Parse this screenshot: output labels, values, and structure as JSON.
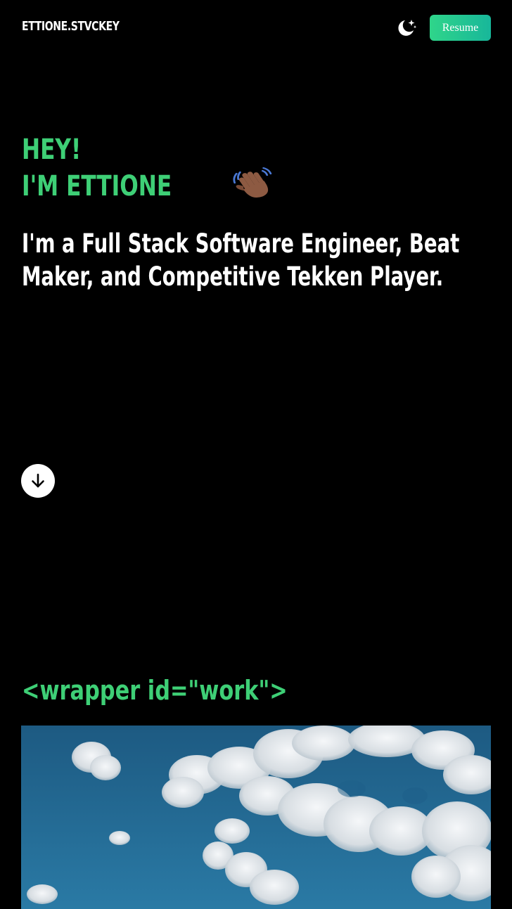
{
  "header": {
    "brand": "ETTIONE.STVCKEY",
    "theme_toggle_icon": "moon-stars-icon",
    "resume_label": "Resume",
    "accent_gradient": [
      "#2fd58a",
      "#18b79a"
    ]
  },
  "hero": {
    "greeting_line1": "HEY!",
    "greeting_line2": "I'M ETTIONE",
    "wave_icon": "waving-hand-icon",
    "tagline": "I'm a Full Stack Software Engineer, Beat Maker, and Competitive Tekken Player.",
    "scroll_icon": "arrow-down-icon"
  },
  "work": {
    "heading": "<wrapper id=\"work\">",
    "image_subject": "sky-with-clouds"
  },
  "colors": {
    "background": "#000000",
    "accent_green": "#3ecf76",
    "text": "#ffffff"
  }
}
